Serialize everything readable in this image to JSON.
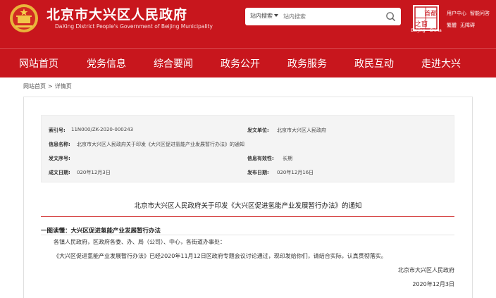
{
  "header": {
    "title": "北京市大兴区人民政府",
    "subtitle": "DaXing District People's Government of Beijing Municipality",
    "search": {
      "scope": "站内搜索",
      "placeholder": "站内搜索"
    },
    "logo": {
      "glyph_top": "首都",
      "glyph_bottom": "之窗",
      "caption": "Beijing—China"
    },
    "util_links": [
      "用户中心",
      "智能问答",
      "繁體",
      "无障碍"
    ],
    "colors": {
      "primary": "#c8161d",
      "accent_line": "#d43b3b"
    }
  },
  "nav": {
    "items": [
      "网站首页",
      "党务信息",
      "综合要闻",
      "政务公开",
      "政务服务",
      "政民互动",
      "走进大兴"
    ]
  },
  "breadcrumb": {
    "home": "网站首页",
    "sep": ">",
    "current": "详情页"
  },
  "info": {
    "index_label": "索引号:",
    "index_value": "11N000/ZK-2020-000243",
    "issuer_label": "发文单位:",
    "issuer_value": "北京市大兴区人民政府",
    "name_label": "信息名称:",
    "name_value": "北京市大兴区人民政府关于印发《大兴区促进氢能产业发展暂行办法》的通知",
    "docno_label": "发文序号:",
    "docno_value": "",
    "validity_label": "信息有效性:",
    "validity_value": "长期",
    "created_label": "成文日期:",
    "created_value": "020年12月3日",
    "published_label": "发布日期:",
    "published_value": "020年12月16日"
  },
  "doc": {
    "title": "北京市大兴区人民政府关于印发《大兴区促进氢能产业发展暂行办法》的通知",
    "reading_prefix": "一图读懂：",
    "reading_link": "大兴区促进氢能产业发展暂行办法",
    "greeting": "各镇人民政府，区政府各委、办、局（公司）、中心，各街道办事处：",
    "body": "《大兴区促进氢能产业发展暂行办法》已经2020年11月12日区政府专题会议讨论通过，现印发给你们，请结合实际，认真贯彻落实。",
    "signature": "北京市大兴区人民政府",
    "date": "2020年12月3日"
  }
}
